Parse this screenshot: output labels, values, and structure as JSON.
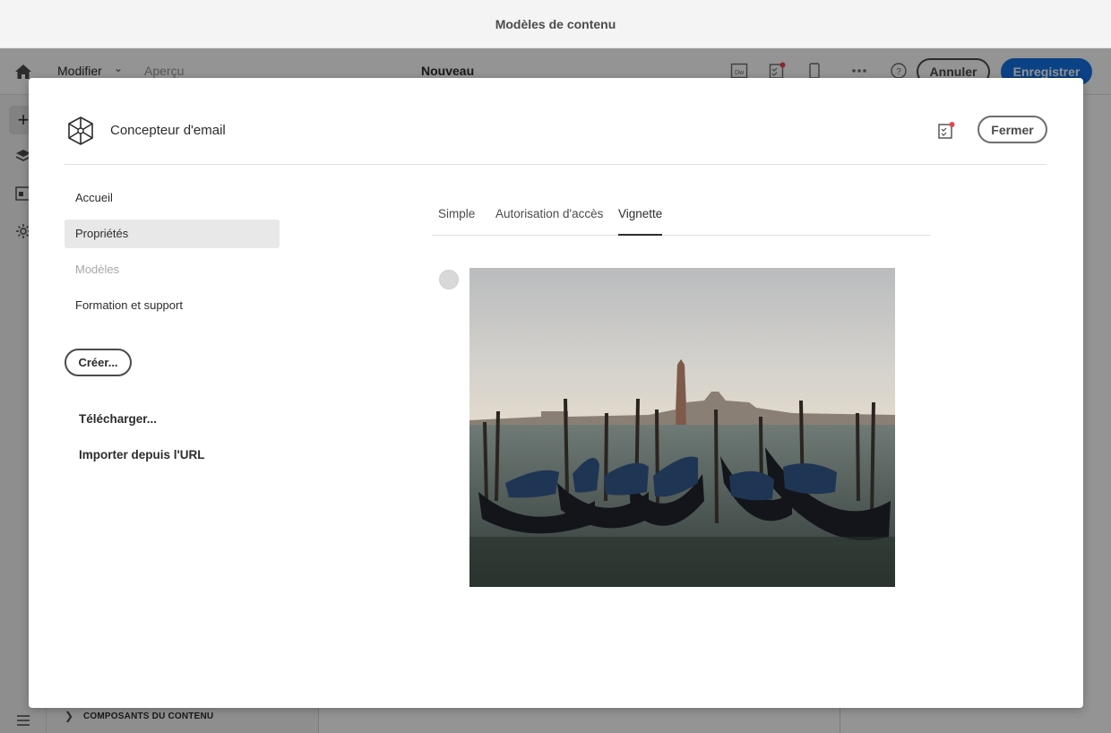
{
  "window": {
    "title": "Modèles de contenu"
  },
  "appbar": {
    "mode_label": "Modifier",
    "preview_label": "Aperçu",
    "document_title": "Nouveau",
    "dw_icon_text": "Dw",
    "cancel_label": "Annuler",
    "save_label": "Enregistrer",
    "accent_color": "#1473e6"
  },
  "bottom_bar": {
    "label": "COMPOSANTS DU CONTENU"
  },
  "modal": {
    "title": "Concepteur d'email",
    "close_label": "Fermer",
    "nav": [
      {
        "label": "Accueil",
        "state": "normal"
      },
      {
        "label": "Propriétés",
        "state": "active"
      },
      {
        "label": "Modèles",
        "state": "disabled"
      },
      {
        "label": "Formation et support",
        "state": "normal"
      }
    ],
    "create_label": "Créer...",
    "upload_label": "Télécharger...",
    "import_label": "Importer depuis l'URL",
    "tabs": [
      {
        "label": "Simple",
        "active": false
      },
      {
        "label": "Autorisation d'accès",
        "active": false
      },
      {
        "label": "Vignette",
        "active": true
      }
    ],
    "thumbnail": {
      "subject": "gondolas-venice-photo",
      "selected": false
    }
  },
  "icons": {
    "home": "home-icon",
    "tasks": "checklist-icon",
    "mobile": "mobile-icon",
    "more": "more-icon",
    "help": "help-icon",
    "logo": "email-designer-logo"
  }
}
